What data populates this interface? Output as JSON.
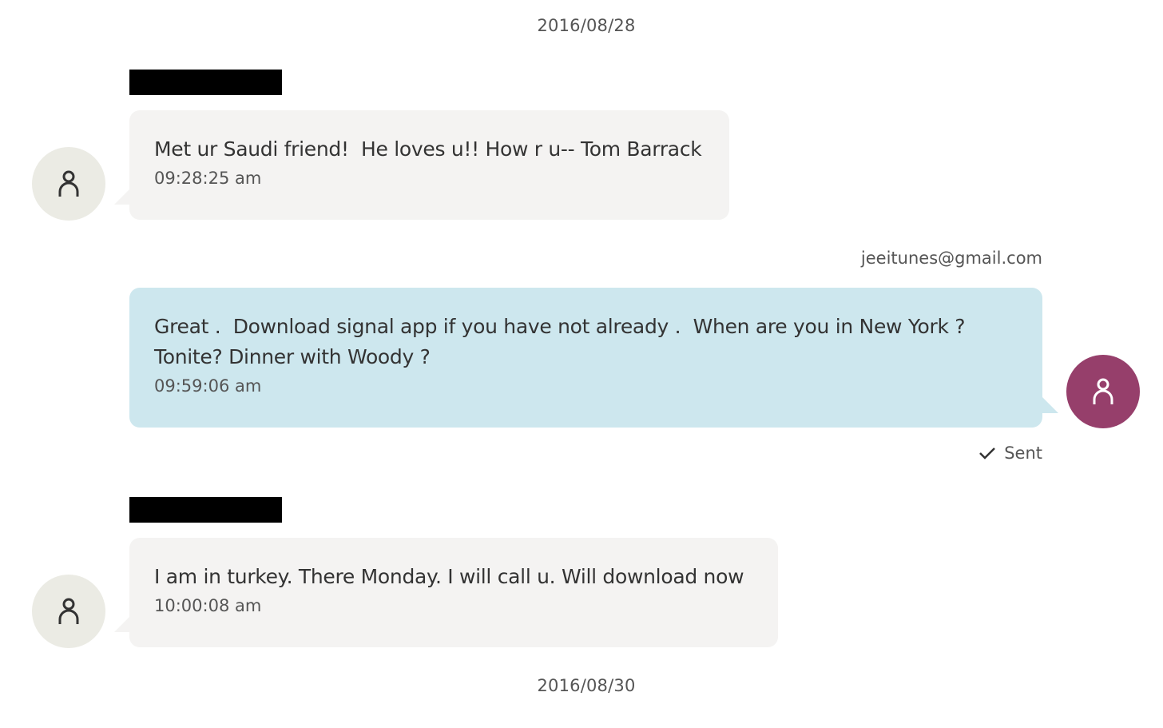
{
  "conversation": {
    "date_separators": [
      "2016/08/28",
      "2016/08/30"
    ],
    "messages": [
      {
        "direction": "incoming",
        "sender": "",
        "text": "Met ur Saudi friend!  He loves u!! How r u-- Tom Barrack",
        "time": "09:28:25 am",
        "avatar_icon": "person-icon"
      },
      {
        "direction": "outgoing",
        "sender": "jeeitunes@gmail.com",
        "text": "Great .  Download signal app if you have not already .  When are you in New York ?\nTonite? Dinner with Woody ?",
        "time": "09:59:06 am",
        "status": "Sent",
        "status_icon": "check-icon",
        "avatar_icon": "person-icon"
      },
      {
        "direction": "incoming",
        "sender": "",
        "text": "I am in turkey. There Monday. I will call u. Will download now",
        "time": "10:00:08 am",
        "avatar_icon": "person-icon"
      }
    ]
  },
  "colors": {
    "incoming_bubble": "#f4f3f2",
    "outgoing_bubble": "#cde7ee",
    "incoming_avatar": "#ebebe4",
    "outgoing_avatar": "#963f6b",
    "redaction": "#000000"
  }
}
